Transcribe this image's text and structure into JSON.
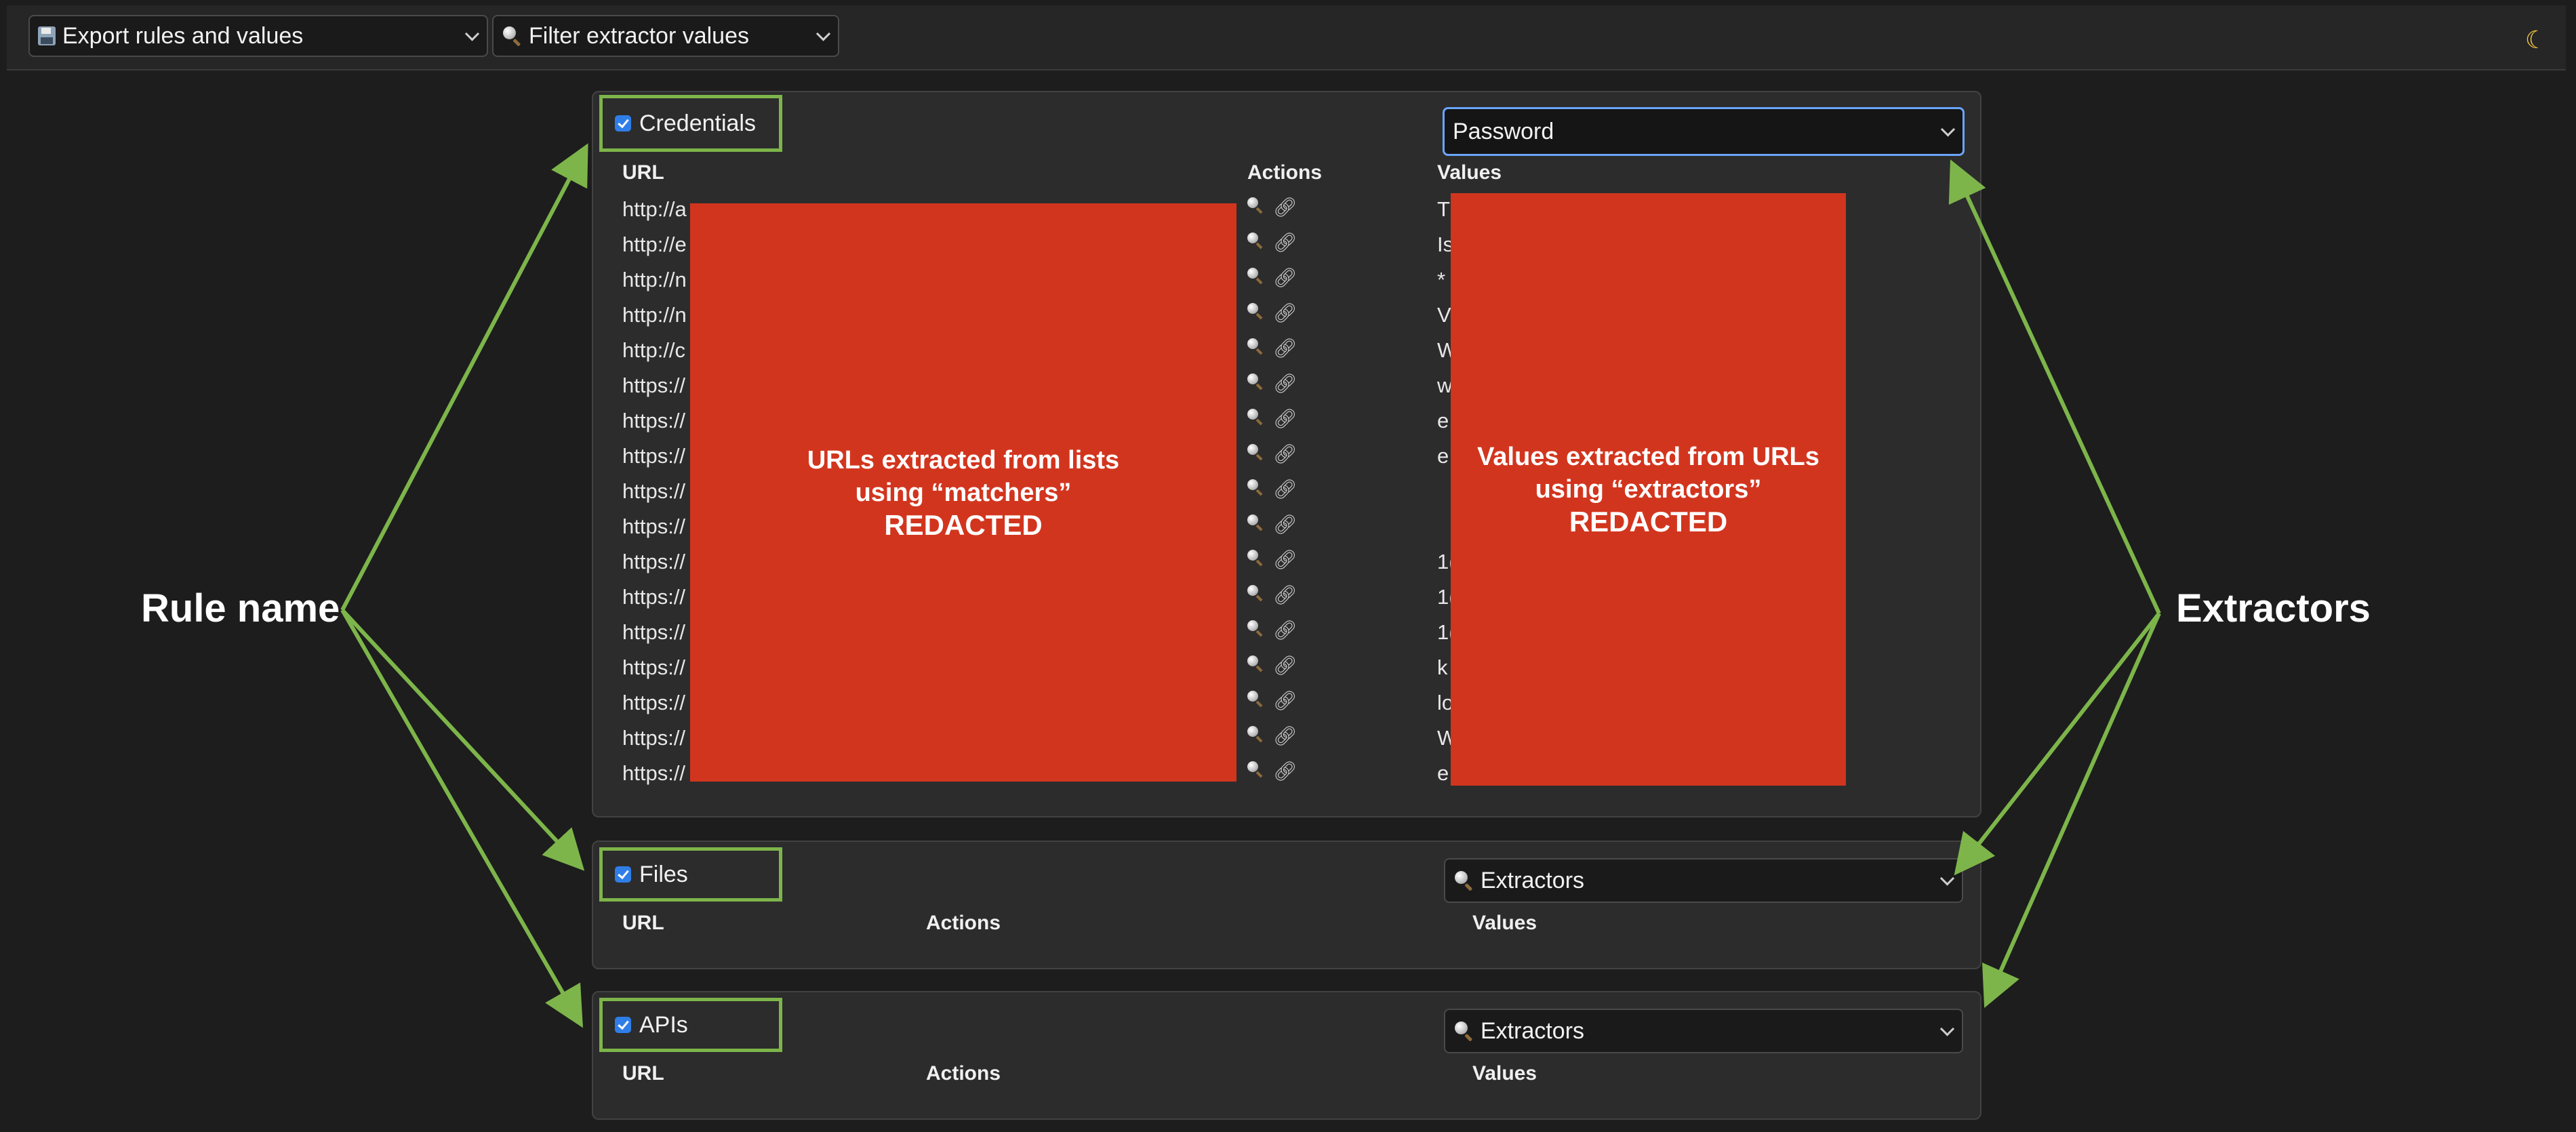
{
  "toolbar": {
    "export_label": "Export rules and values",
    "filter_label": "Filter extractor values",
    "theme_icon": "moon-icon"
  },
  "rules": [
    {
      "name": "Credentials",
      "checked": true,
      "extractor_selected": "Password",
      "headers": {
        "url": "URL",
        "actions": "Actions",
        "values": "Values"
      },
      "rows": [
        {
          "url": "http://a",
          "value": "T"
        },
        {
          "url": "http://e",
          "value": "Is"
        },
        {
          "url": "http://n",
          "value": "*"
        },
        {
          "url": "http://n",
          "value": "V"
        },
        {
          "url": "http://c",
          "value": "W"
        },
        {
          "url": "https://",
          "value": "w"
        },
        {
          "url": "https://",
          "value": "e"
        },
        {
          "url": "https://",
          "value": "e"
        },
        {
          "url": "https://",
          "value": ""
        },
        {
          "url": "https://",
          "value": ""
        },
        {
          "url": "https://",
          "value": "1("
        },
        {
          "url": "https://",
          "value": "1("
        },
        {
          "url": "https://",
          "value": "1("
        },
        {
          "url": "https://",
          "value": "k"
        },
        {
          "url": "https://",
          "value": "lo"
        },
        {
          "url": "https://",
          "value": "W"
        },
        {
          "url": "https://",
          "value": "e"
        }
      ]
    },
    {
      "name": "Files",
      "checked": true,
      "extractor_selected": "Extractors",
      "headers": {
        "url": "URL",
        "actions": "Actions",
        "values": "Values"
      }
    },
    {
      "name": "APIs",
      "checked": true,
      "extractor_selected": "Extractors",
      "headers": {
        "url": "URL",
        "actions": "Actions",
        "values": "Values"
      }
    }
  ],
  "redactions": {
    "urls": {
      "line1": "URLs extracted from lists",
      "line2": "using “matchers”",
      "tag": "REDACTED"
    },
    "values": {
      "line1": "Values extracted from URLs",
      "line2": "using “extractors”",
      "tag": "REDACTED"
    }
  },
  "callouts": {
    "left": "Rule name",
    "right": "Extractors"
  },
  "colors": {
    "background": "#1d1d1d",
    "panel": "#2c2c2c",
    "highlight_green": "#7db54a",
    "redact_red": "#d2351e",
    "checkbox_blue": "#2f7ee8",
    "focus_blue": "#6aa6ff"
  }
}
